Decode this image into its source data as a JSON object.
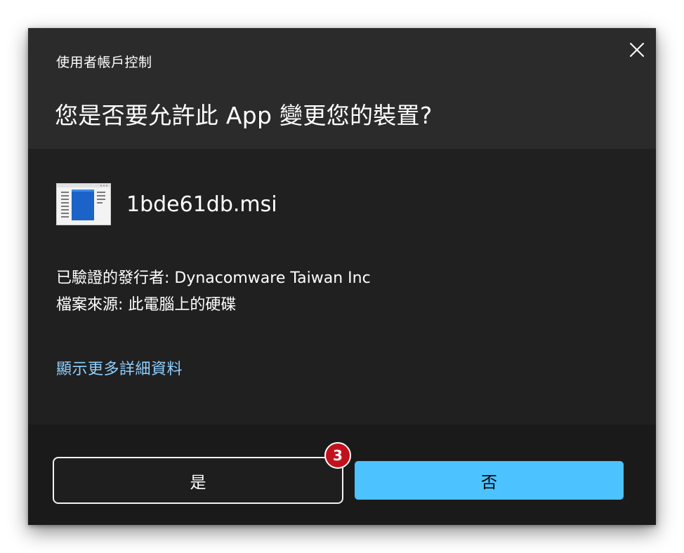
{
  "dialog": {
    "app_title": "使用者帳戶控制",
    "question": "您是否要允許此 App 變更您的裝置?",
    "close_icon": "close-icon"
  },
  "file": {
    "icon": "installer-file-icon",
    "name": "1bde61db.msi"
  },
  "info": {
    "publisher": "已驗證的發行者: Dynacomware Taiwan Inc",
    "origin": "檔案來源: 此電腦上的硬碟"
  },
  "details_link": "顯示更多詳細資料",
  "buttons": {
    "yes": "是",
    "no": "否"
  },
  "annotation": {
    "step": "3"
  },
  "colors": {
    "accent": "#4cc2ff",
    "link": "#8fd0ff",
    "badge": "#c1121c",
    "header_bg": "#2b2b2b",
    "body_bg": "#202020",
    "footer_bg": "#1a1a1a"
  }
}
